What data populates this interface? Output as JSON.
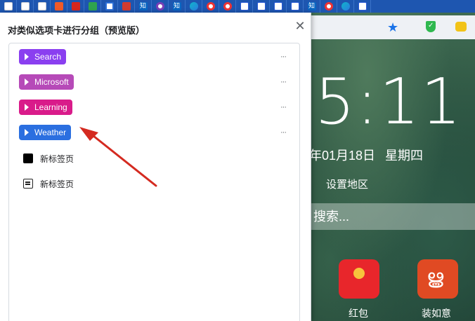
{
  "tabstrip": {
    "tabs": [
      {
        "icon": "document-icon"
      },
      {
        "icon": "document-icon"
      },
      {
        "icon": "document-icon"
      },
      {
        "icon": "orange-app-icon"
      },
      {
        "icon": "red-app-icon"
      },
      {
        "icon": "green-app-icon"
      },
      {
        "icon": "box-app-icon"
      },
      {
        "icon": "pdf-icon"
      },
      {
        "icon": "zhihu-icon",
        "text": "知"
      },
      {
        "icon": "ring-icon"
      },
      {
        "icon": "zhihu-icon",
        "text": "知"
      },
      {
        "icon": "edge-icon"
      },
      {
        "icon": "eye-icon"
      },
      {
        "icon": "eye-icon"
      },
      {
        "icon": "baidu-icon"
      },
      {
        "icon": "baidu-icon"
      },
      {
        "icon": "baidu-icon"
      },
      {
        "icon": "baidu-icon"
      },
      {
        "icon": "zhihu-icon",
        "text": "知"
      },
      {
        "icon": "eye-icon"
      },
      {
        "icon": "edge-icon"
      },
      {
        "icon": "baidu-icon"
      }
    ]
  },
  "panel": {
    "title": "对类似选项卡进行分组（预览版）",
    "close_label": "✕",
    "groups": [
      {
        "label": "Search",
        "color": "#8a3ff0",
        "more": "···"
      },
      {
        "label": "Microsoft",
        "color": "#b64ab8",
        "more": "···"
      },
      {
        "label": "Learning",
        "color": "#d91b8a",
        "more": "···"
      },
      {
        "label": "Weather",
        "color": "#2b6fe0",
        "more": "···"
      }
    ],
    "ungrouped_tabs": [
      {
        "label": "新标签页",
        "icon": "black-square-icon"
      },
      {
        "label": "新标签页",
        "icon": "calendar-icon"
      }
    ]
  },
  "newtab": {
    "clock": "5:11",
    "date": "年01月18日",
    "weekday": "星期四",
    "region_link": "设置地区",
    "search_placeholder": "搜索...",
    "apps": [
      {
        "label": "红包",
        "icon": "red-envelope-icon"
      },
      {
        "label": "装如意",
        "icon": "ruyi-icon"
      }
    ]
  },
  "colors": {
    "tabstrip": "#1e56b0",
    "arrow": "#d42a20",
    "favorite_star": "#1a73e8"
  }
}
